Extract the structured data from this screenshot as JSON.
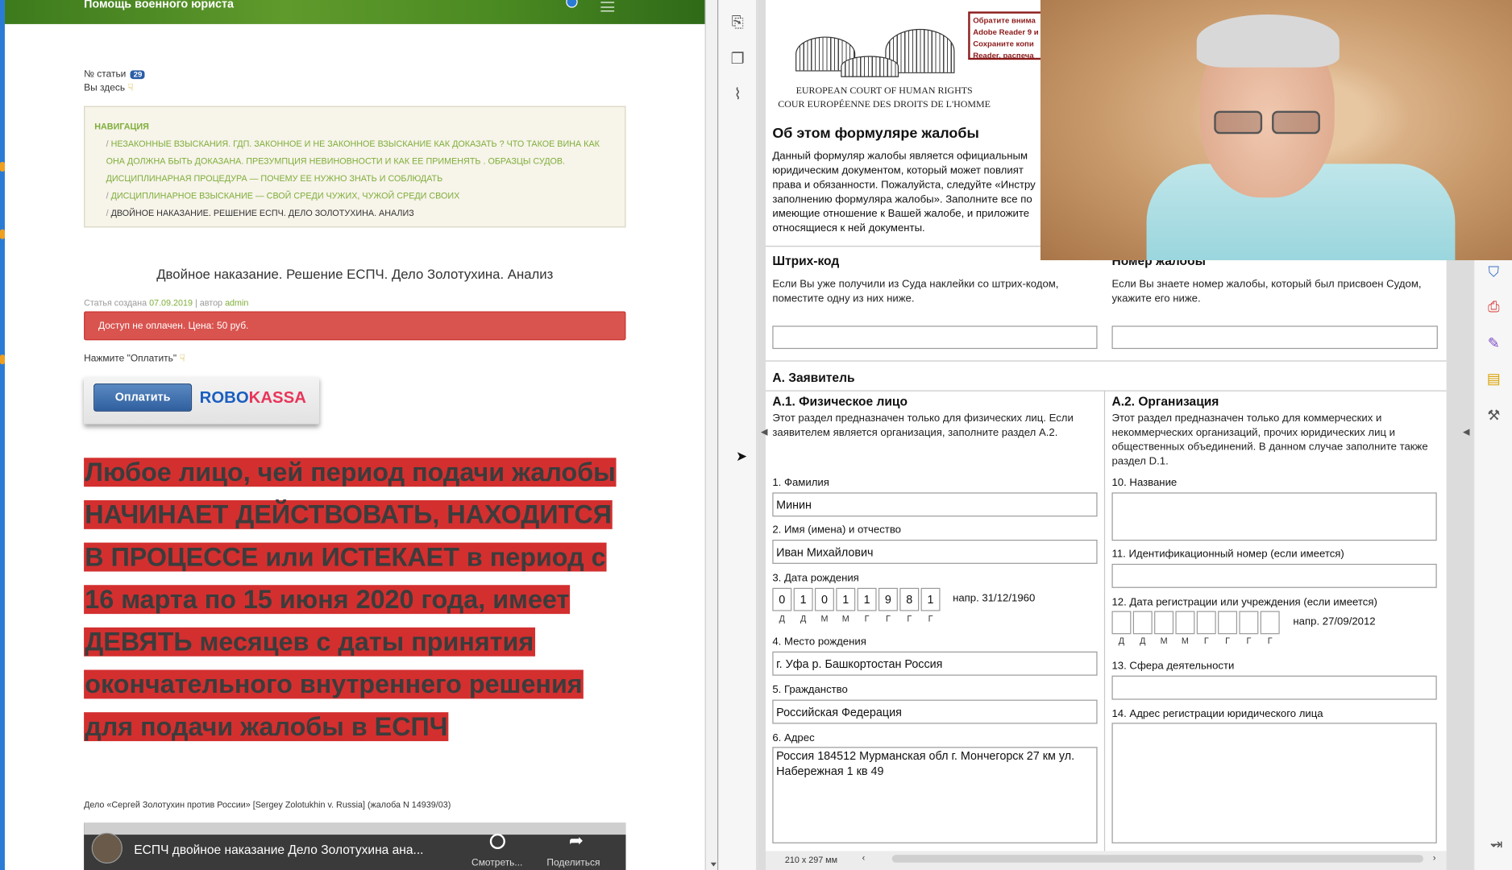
{
  "site": {
    "title": "Помощь военного юриста",
    "article_no_label": "№ статьи",
    "article_no": "29",
    "you_are_here": "Вы здесь",
    "nav_title": "Навигация",
    "breadcrumbs": [
      "Незаконные взыскания. ГДП. Законное и не законное взыскание как доказать ? Что такое вина как она должна быть доказана. Презумпция невиновности и как ее применять . Образцы судов. Дисциплинарная процедура — почему ее нужно знать и соблюдать",
      "Дисциплинарное взыскание — свой среди чужих, чужой среди своих",
      "Двойное наказание. Решение ЕСПЧ. Дело Золотухина. Анализ"
    ],
    "article_title": "Двойное наказание. Решение ЕСПЧ. Дело Золотухина. Анализ",
    "created_prefix": "Статья создана",
    "created_date": "07.09.2019",
    "author_prefix": "| автор",
    "author": "admin",
    "alert": "Доступ не оплачен. Цена: 50 руб.",
    "press_pay": "Нажмите \"Оплатить\"",
    "pay_button": "Оплатить",
    "robokassa_a": "ROBO",
    "robokassa_b": "KASSA",
    "highlight_text": "Любое лицо, чей период подачи жалобы НАЧИНАЕТ ДЕЙСТВОВАТЬ, НАХОДИТСЯ В ПРОЦЕССЕ или ИСТЕКАЕТ в период с 16 марта по 15 июня 2020 года, имеет ДЕВЯТЬ месяцев с даты принятия окончательного внутреннего решения для подачи жалобы в ЕСПЧ",
    "case_line": "Дело «Сергей Золотухин против России» [Sergey Zolotukhin v. Russia] (жалоба N 14939/03)",
    "video_title": "ЕСПЧ двойное наказание Дело Золотухина ана...",
    "video_later": "Смотреть...",
    "video_share": "Поделиться"
  },
  "pdf": {
    "court_en": "EUROPEAN COURT OF HUMAN RIGHTS",
    "court_fr": "COUR EUROPÉENNE DES DROITS DE L'HOMME",
    "warning_lines": [
      "Обратите внима",
      "Adobe Reader 9 и",
      "Сохраните копи",
      "Reader, распеча"
    ],
    "about_title": "Об этом формуляре жалобы",
    "about_text": "Данный формуляр жалобы является официальным юридическим документом, который может повлият права и обязанности. Пожалуйста, следуйте «Инстру заполнению формуляра жалобы». Заполните все по имеющие отношение к Вашей жалобе, и приложите относящиеся к ней документы.",
    "barcode_title": "Штрих-код",
    "barcode_help": "Если Вы уже получили из Суда наклейки со штрих-кодом, поместите одну из них ниже.",
    "app_no_title": "Номер жалобы",
    "app_no_help": "Если Вы знаете номер жалобы, который был присвоен Судом, укажите его ниже.",
    "section_a": "А. Заявитель",
    "a1_title": "А.1. Физическое лицо",
    "a1_help": "Этот раздел предназначен только для физических лиц. Если заявителем является организация, заполните раздел А.2.",
    "a2_title": "А.2. Организация",
    "a2_help": "Этот раздел предназначен только для коммерческих и некоммерческих организаций, прочих юридических лиц и общественных объединений. В данном случае заполните также раздел D.1.",
    "f1_label": "1. Фамилия",
    "f1_value": "Минин",
    "f2_label": "2. Имя (имена) и отчество",
    "f2_value": "Иван Михайлович",
    "f3_label": "3. Дата рождения",
    "f3_digits": [
      "0",
      "1",
      "0",
      "1",
      "1",
      "9",
      "8",
      "1"
    ],
    "date_letters": [
      "Д",
      "Д",
      "М",
      "М",
      "Г",
      "Г",
      "Г",
      "Г"
    ],
    "f3_example": "напр. 31/12/1960",
    "f4_label": "4. Место рождения",
    "f4_value": "г. Уфа р. Башкортостан Россия",
    "f5_label": "5. Гражданство",
    "f5_value": "Российская Федерация",
    "f6_label": "6. Адрес",
    "f6_value": "Россия  184512 Мурманская обл г. Мончегорск 27 км ул. Набережная 1 кв 49",
    "f10_label": "10. Название",
    "f11_label": "11. Идентификационный номер (если имеется)",
    "f12_label": "12.  Дата регистрации или учреждения (если имеется)",
    "f12_example": "напр. 27/09/2012",
    "f13_label": "13. Сфера деятельности",
    "f14_label": "14. Адрес регистрации юридического лица",
    "page_size": "210 x 297 мм"
  },
  "colors": {
    "alert": "#d9534f",
    "highlight": "#d32f2f",
    "nav_link": "#7fae3a",
    "header_green": "#4b8a22"
  }
}
